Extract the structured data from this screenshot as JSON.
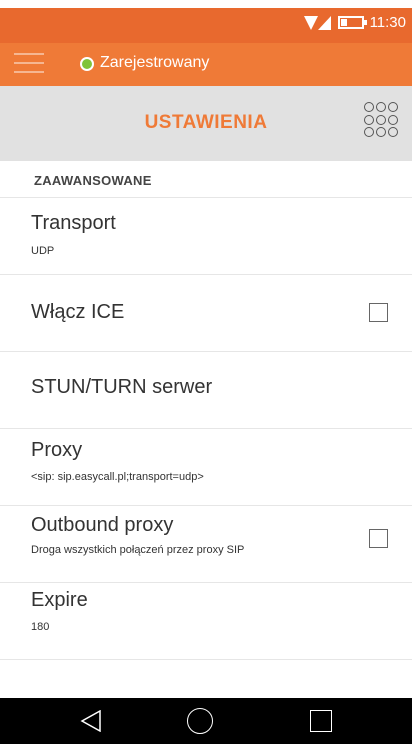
{
  "status_bar": {
    "time": "11:30"
  },
  "registration": {
    "status_text": "Zarejestrowany",
    "status_color": "#7fc43a"
  },
  "header": {
    "title": "USTAWIENIA"
  },
  "section": {
    "title": "ZAAWANSOWANE"
  },
  "settings": [
    {
      "title": "Transport",
      "subtitle": "UDP"
    },
    {
      "title": "Włącz ICE",
      "checked": false
    },
    {
      "title": "STUN/TURN serwer"
    },
    {
      "title": "Proxy",
      "subtitle": "<sip: sip.easycall.pl;transport=udp>"
    },
    {
      "title": "Outbound proxy",
      "subtitle": "Droga wszystkich połączeń przez proxy SIP",
      "checked": false
    },
    {
      "title": "Expire",
      "subtitle": "180"
    }
  ],
  "colors": {
    "accent": "#ef7a37",
    "status_bar": "#e8692e",
    "header_bg": "#e1e1e1"
  }
}
